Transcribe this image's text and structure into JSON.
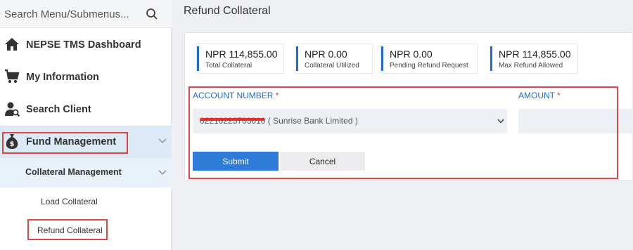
{
  "search": {
    "placeholder": "Search Menu/Submenus...",
    "icon": "search-icon"
  },
  "sidebar": {
    "items": [
      {
        "label": "NEPSE TMS Dashboard",
        "icon": "home-icon"
      },
      {
        "label": "My Information",
        "icon": "cart-icon"
      },
      {
        "label": "Search Client",
        "icon": "user-search-icon"
      },
      {
        "label": "Fund Management",
        "icon": "money-bag-icon",
        "expanded": true
      }
    ],
    "submenu": {
      "label": "Collateral Management",
      "children": [
        {
          "label": "Load Collateral"
        },
        {
          "label": "Refund Collateral",
          "active": true
        }
      ]
    }
  },
  "page": {
    "title": "Refund Collateral"
  },
  "stats": [
    {
      "value": "NPR 114,855.00",
      "label": "Total Collateral"
    },
    {
      "value": "NPR 0.00",
      "label": "Collateral Utilized"
    },
    {
      "value": "NPR 0.00",
      "label": "Pending Refund Request"
    },
    {
      "value": "NPR 114,855.00",
      "label": "Max Refund Allowed"
    }
  ],
  "form": {
    "account_label": "ACCOUNT NUMBER",
    "amount_label": "AMOUNT",
    "required_marker": "*",
    "account_value": "02210223703010 ( Sunrise Bank Limited )",
    "amount_value": "",
    "submit_label": "Submit",
    "cancel_label": "Cancel"
  },
  "colors": {
    "accent": "#1f6bd1",
    "submit": "#2e7bd8",
    "highlight": "#e04444",
    "active_bg": "#dceaf8"
  }
}
